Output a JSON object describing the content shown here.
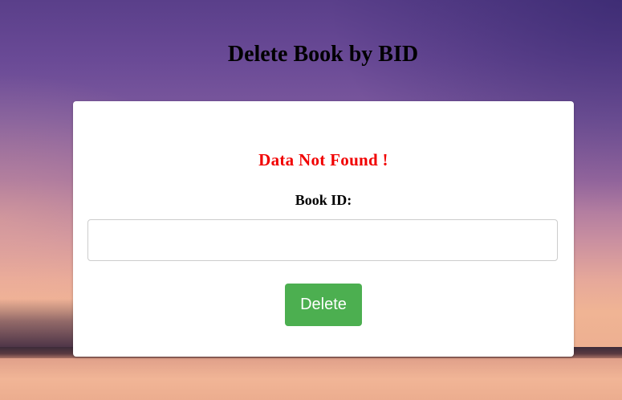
{
  "page": {
    "title": "Delete Book by BID"
  },
  "form": {
    "error_message": "Data Not Found !",
    "book_id_label": "Book ID:",
    "book_id_value": "",
    "book_id_placeholder": "",
    "submit_label": "Delete"
  },
  "colors": {
    "error": "#f10000",
    "button": "#4caf50",
    "card": "#ffffff"
  }
}
